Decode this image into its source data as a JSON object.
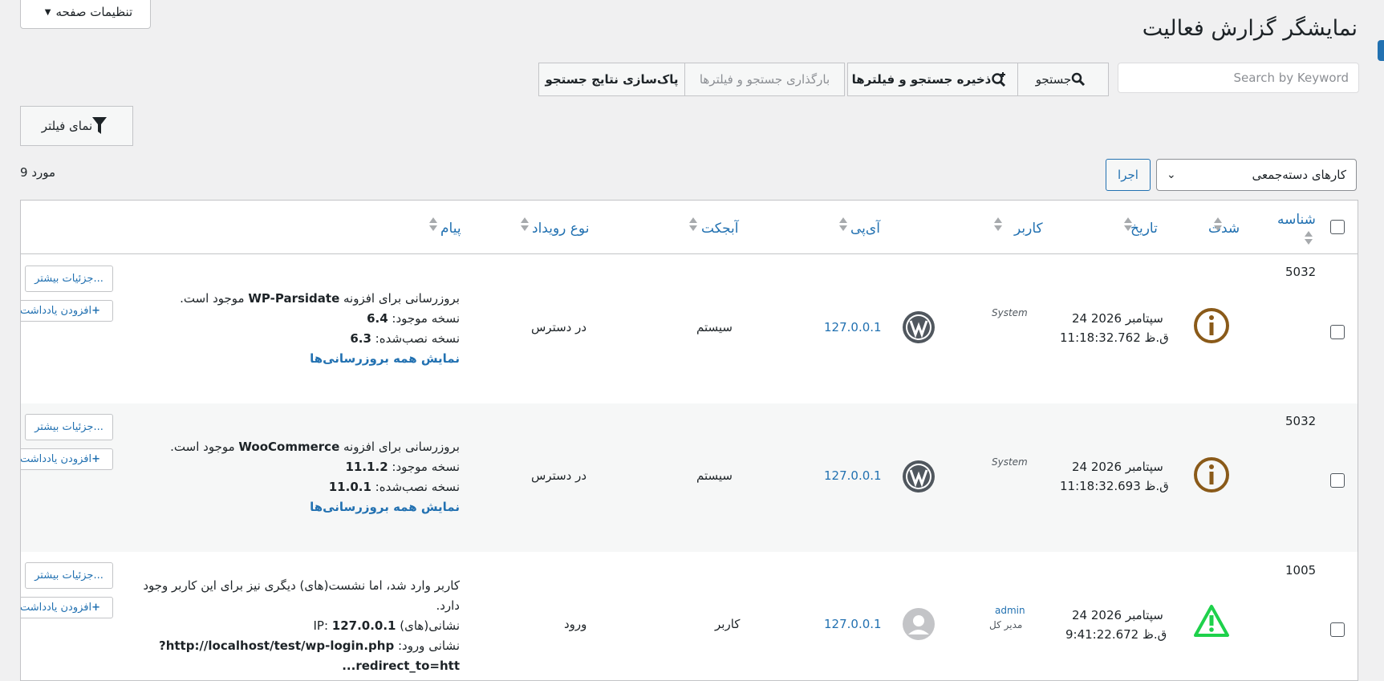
{
  "header": {
    "title": "نمایشگر گزارش فعالیت",
    "page_settings_label": "تنظیمات صفحه"
  },
  "search": {
    "placeholder": "Search by Keyword",
    "search_label": "جستجو",
    "save_label": "ذخیره جستجو و فیلترها",
    "load_label": "بارگذاری جستجو و فیلترها",
    "clear_label": "پاک‌سازی نتایج جستجو"
  },
  "filter": {
    "label": "نمای فیلتر"
  },
  "bulk": {
    "selected": "کارهای دسته‌جمعی",
    "apply_label": "اجرا"
  },
  "count_label": "9 مورد",
  "table": {
    "columns": {
      "id": "شناسه",
      "severity": "شدت",
      "date": "تاریخ",
      "user": "کاربر",
      "ip": "آی‌پی",
      "object": "آبجکت",
      "event_type": "نوع رویداد",
      "message": "پیام"
    },
    "rows": [
      {
        "id": "5032",
        "severity": "info",
        "date": "24 سپتامبر 2026",
        "time": "11:18:32.762 ق.ظ",
        "user": "System",
        "user_role": "",
        "avatar": "wordpress-icon",
        "ip": "127.0.0.1",
        "object": "سیستم",
        "event_type": "در دسترس",
        "msg_line1_a": "بروزرسانی برای افزونه ",
        "msg_line1_b": "WP-Parsidate",
        "msg_line1_c": " موجود است.",
        "msg_line2_a": "نسخه موجود: ",
        "msg_line2_b": "6.4",
        "msg_line3_a": "نسخه نصب‌شده: ",
        "msg_line3_b": "6.3",
        "msg_line4": "نمایش همه بروزرسانی‌ها",
        "details_label": "جزئیات بیشتر...",
        "note_label": "افزودن یادداشت"
      },
      {
        "id": "5032",
        "severity": "info",
        "date": "24 سپتامبر 2026",
        "time": "11:18:32.693 ق.ظ",
        "user": "System",
        "user_role": "",
        "avatar": "wordpress-icon",
        "ip": "127.0.0.1",
        "object": "سیستم",
        "event_type": "در دسترس",
        "msg_line1_a": "بروزرسانی برای افزونه ",
        "msg_line1_b": "WooCommerce",
        "msg_line1_c": " موجود است.",
        "msg_line2_a": "نسخه موجود: ",
        "msg_line2_b": "11.1.2",
        "msg_line3_a": "نسخه نصب‌شده: ",
        "msg_line3_b": "11.0.1",
        "msg_line4": "نمایش همه بروزرسانی‌ها",
        "details_label": "جزئیات بیشتر...",
        "note_label": "افزودن یادداشت"
      },
      {
        "id": "1005",
        "severity": "warning",
        "date": "24 سپتامبر 2026",
        "time": "9:41:22.672 ق.ظ",
        "user": "admin",
        "user_role": "مدیر کل",
        "avatar": "user-avatar-icon",
        "ip": "127.0.0.1",
        "object": "کاربر",
        "event_type": "ورود",
        "msg_line1": "کاربر وارد شد، اما نشست(های) دیگری نیز برای این کاربر وجود",
        "msg_line2": "دارد.",
        "msg_line3_a": "نشانی(های) IP: ",
        "msg_line3_b": "127.0.0.1",
        "msg_line4_a": "نشانی ورود: ",
        "msg_line4_b": "http://localhost/test/wp-login.php?",
        "msg_line5": "redirect_to=htt...",
        "details_label": "جزئیات بیشتر...",
        "note_label": "افزودن یادداشت"
      }
    ]
  },
  "colors": {
    "info": "#8a5a19",
    "warning": "#1ed14b",
    "link": "#2271b1"
  }
}
